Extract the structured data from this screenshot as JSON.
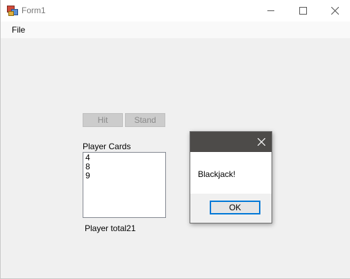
{
  "window": {
    "title": "Form1"
  },
  "menu": {
    "file": "File"
  },
  "buttons": {
    "hit": "Hit",
    "stand": "Stand"
  },
  "player": {
    "cards_label": "Player Cards",
    "cards": [
      "4",
      "8",
      "9"
    ],
    "total_label": "Player total21"
  },
  "dialog": {
    "message": "Blackjack!",
    "ok": "OK"
  }
}
